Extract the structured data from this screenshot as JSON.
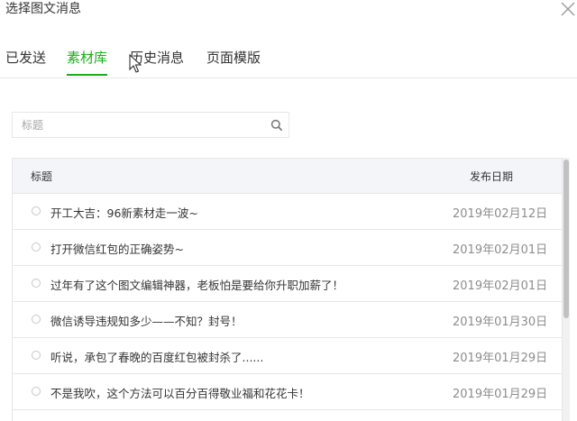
{
  "dialog": {
    "title": "选择图文消息"
  },
  "tabs": [
    {
      "label": "已发送",
      "active": false
    },
    {
      "label": "素材库",
      "active": true
    },
    {
      "label": "历史消息",
      "active": false
    },
    {
      "label": "页面模版",
      "active": false
    }
  ],
  "search": {
    "placeholder": "标题",
    "value": ""
  },
  "table": {
    "headers": {
      "title": "标题",
      "date": "发布日期"
    },
    "rows": [
      {
        "title": "开工大吉：96新素材走一波~",
        "date": "2019年02月12日"
      },
      {
        "title": "打开微信红包的正确姿势~",
        "date": "2019年02月01日"
      },
      {
        "title": "过年有了这个图文编辑神器，老板怕是要给你升职加薪了！",
        "date": "2019年02月01日"
      },
      {
        "title": "微信诱导违规知多少——不知？封号！",
        "date": "2019年01月30日"
      },
      {
        "title": "听说，承包了春晚的百度红包被封杀了......",
        "date": "2019年01月29日"
      },
      {
        "title": "不是我吹，这个方法可以百分百得敬业福和花花卡！",
        "date": "2019年01月29日"
      }
    ]
  },
  "icons": {
    "close": "close-icon",
    "search": "search-icon",
    "cursor": "mouse-cursor-icon",
    "radio": "radio-unselected-icon"
  },
  "colors": {
    "accent": "#1aad19",
    "border": "#e7e7eb",
    "header_bg": "#f4f5f9",
    "date_text": "#8d8d8d"
  }
}
